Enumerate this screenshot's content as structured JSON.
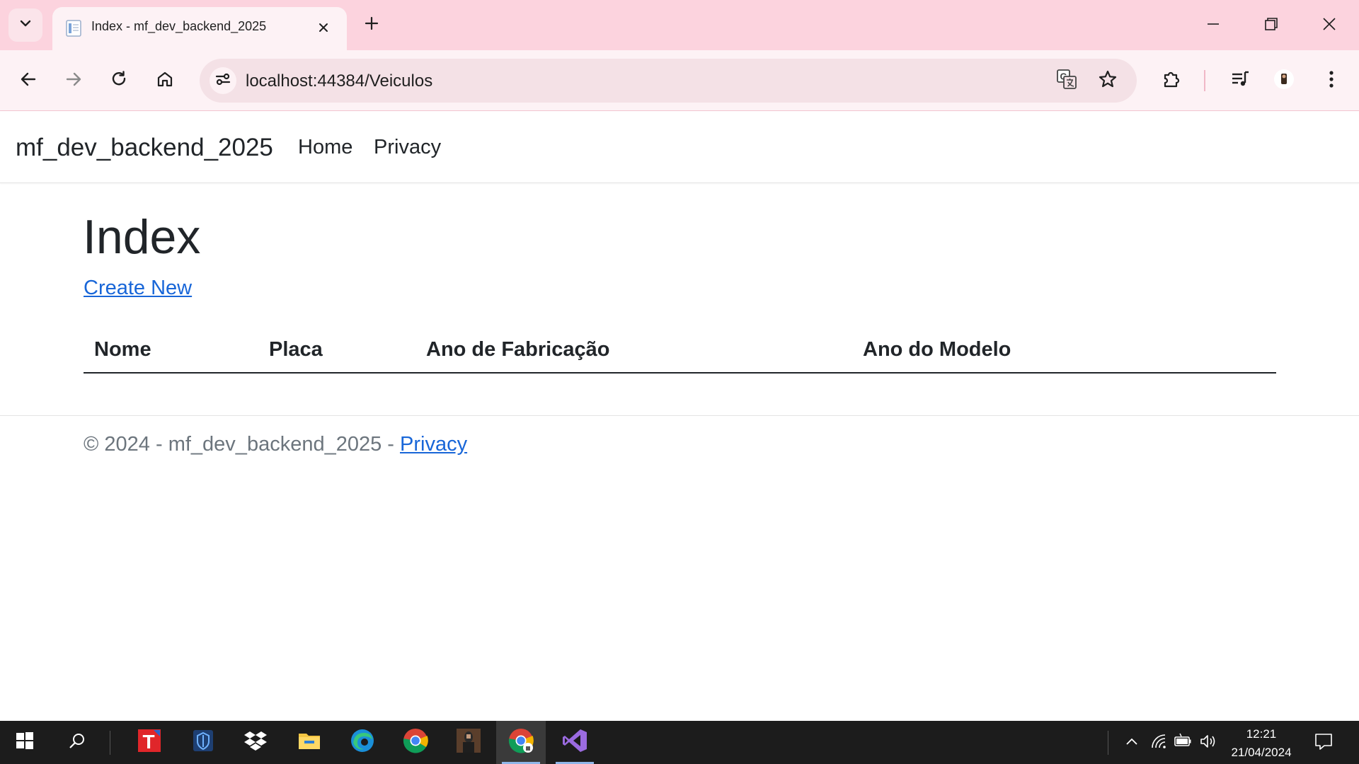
{
  "browser": {
    "tab_title": "Index - mf_dev_backend_2025",
    "url": "localhost:44384/Veiculos",
    "colors": {
      "tabstrip": "#fcd3de",
      "toolbar": "#fdf2f5",
      "omnibox": "#f4e1e6"
    }
  },
  "site": {
    "brand": "mf_dev_backend_2025",
    "nav": [
      {
        "label": "Home"
      },
      {
        "label": "Privacy"
      }
    ]
  },
  "page": {
    "title": "Index",
    "create_label": "Create New",
    "table": {
      "headers": [
        "Nome",
        "Placa",
        "Ano de Fabricação",
        "Ano do Modelo"
      ],
      "rows": []
    }
  },
  "footer": {
    "text": "© 2024 - mf_dev_backend_2025 - ",
    "link": "Privacy"
  },
  "taskbar": {
    "apps": [
      "start-icon",
      "search-icon",
      "t-app-icon",
      "shield-app-icon",
      "dropbox-icon",
      "file-explorer-icon",
      "edge-icon",
      "chrome-icon",
      "person-app-icon",
      "chrome-active-icon",
      "visual-studio-icon"
    ],
    "time": "12:21",
    "date": "21/04/2024"
  }
}
